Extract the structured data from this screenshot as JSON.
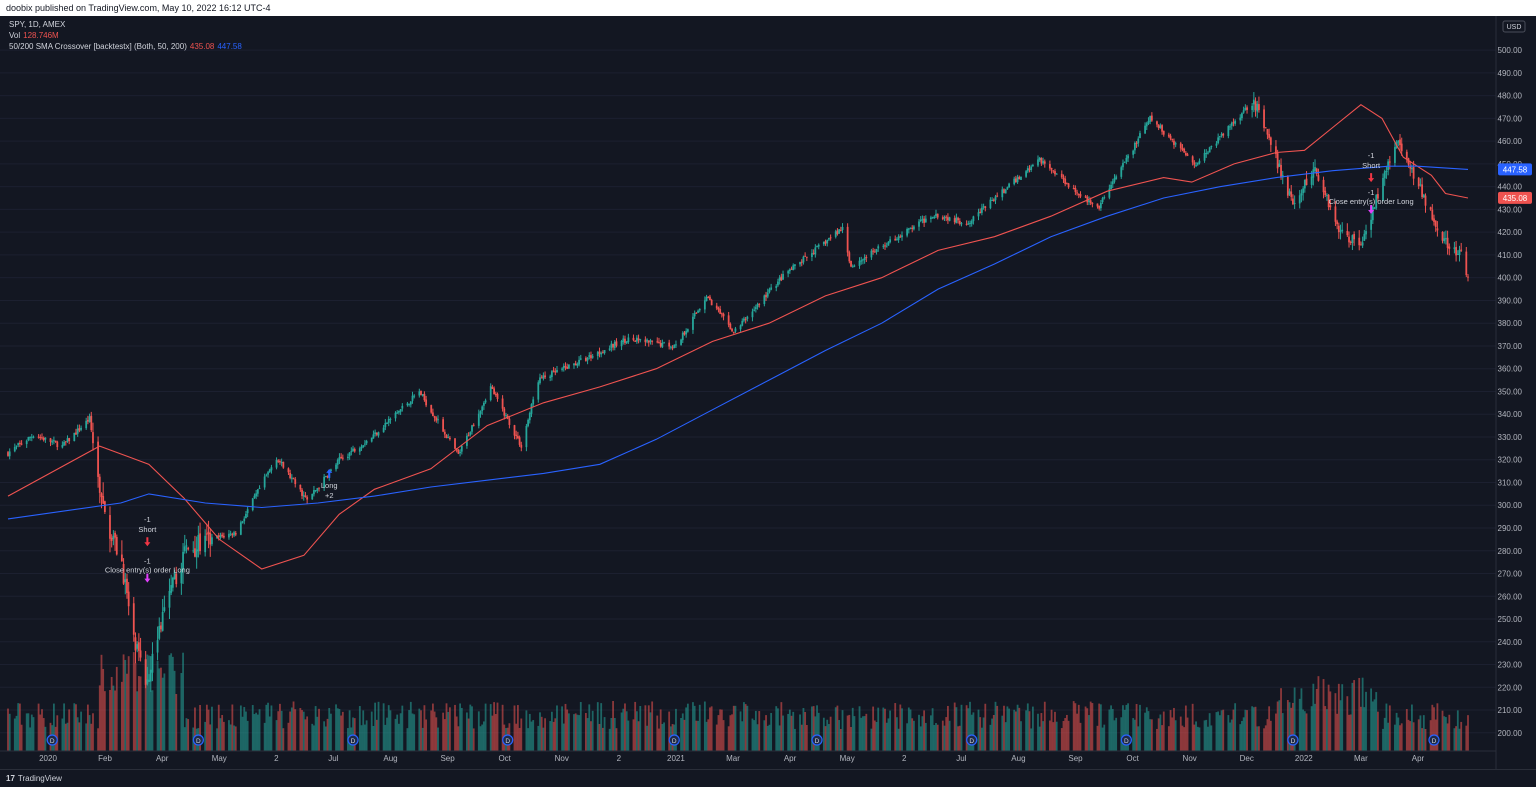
{
  "header": {
    "published": "doobix published on TradingView.com, May 10, 2022 16:12 UTC-4"
  },
  "legend": {
    "symbol": "SPY, 1D, AMEX",
    "vol_label": "Vol",
    "vol_value": "128.746M",
    "indicator_label": "50/200 SMA Crossover [backtestx] (Both, 50, 200)",
    "indicator_value_1": "435.08",
    "indicator_value_2": "447.58"
  },
  "colors": {
    "background": "#131722",
    "grid": "#1c2030",
    "up": "#26a69a",
    "down": "#ef5350",
    "sma50": "#ef5350",
    "sma200": "#2962ff",
    "text": "#d1d4dc",
    "signal_short": "#f23645",
    "signal_long": "#2962ff",
    "signal_close": "#e040fb"
  },
  "footer": {
    "logo_mark": "17",
    "brand": "TradingView"
  },
  "chart_data": {
    "type": "candlestick",
    "symbol": "SPY",
    "interval": "1D",
    "currency": "USD",
    "y_axis": {
      "range": [
        192,
        515
      ],
      "ticks": [
        200,
        210,
        220,
        230,
        240,
        250,
        260,
        270,
        280,
        290,
        300,
        310,
        320,
        330,
        340,
        350,
        360,
        370,
        380,
        390,
        400,
        410,
        420,
        430,
        440,
        450,
        460,
        470,
        480,
        490,
        500
      ]
    },
    "x_axis": {
      "labels": [
        "2020",
        "Feb",
        "Apr",
        "May",
        "2",
        "Jul",
        "Aug",
        "Sep",
        "Oct",
        "Nov",
        "2",
        "2021",
        "Mar",
        "Apr",
        "May",
        "2",
        "Jul",
        "Aug",
        "Sep",
        "Oct",
        "Nov",
        "Dec",
        "2022",
        "Mar",
        "Apr"
      ]
    },
    "price_path": [
      [
        "2020-01-02",
        323
      ],
      [
        "2020-01-17",
        331
      ],
      [
        "2020-02-03",
        326
      ],
      [
        "2020-02-19",
        338
      ],
      [
        "2020-02-27",
        297
      ],
      [
        "2020-03-09",
        275
      ],
      [
        "2020-03-16",
        240
      ],
      [
        "2020-03-23",
        222
      ],
      [
        "2020-04-01",
        248
      ],
      [
        "2020-04-15",
        280
      ],
      [
        "2020-05-01",
        285
      ],
      [
        "2020-05-15",
        288
      ],
      [
        "2020-06-08",
        321
      ],
      [
        "2020-06-26",
        302
      ],
      [
        "2020-07-15",
        320
      ],
      [
        "2020-08-03",
        330
      ],
      [
        "2020-08-31",
        350
      ],
      [
        "2020-09-23",
        322
      ],
      [
        "2020-10-12",
        352
      ],
      [
        "2020-10-30",
        326
      ],
      [
        "2020-11-09",
        355
      ],
      [
        "2020-11-30",
        362
      ],
      [
        "2020-12-31",
        373
      ],
      [
        "2021-01-29",
        370
      ],
      [
        "2021-02-16",
        392
      ],
      [
        "2021-03-04",
        376
      ],
      [
        "2021-04-01",
        400
      ],
      [
        "2021-05-07",
        422
      ],
      [
        "2021-05-12",
        405
      ],
      [
        "2021-06-30",
        428
      ],
      [
        "2021-07-19",
        424
      ],
      [
        "2021-08-31",
        452
      ],
      [
        "2021-10-04",
        430
      ],
      [
        "2021-11-04",
        470
      ],
      [
        "2021-12-01",
        450
      ],
      [
        "2021-12-31",
        475
      ],
      [
        "2022-01-04",
        478
      ],
      [
        "2022-01-27",
        432
      ],
      [
        "2022-02-09",
        448
      ],
      [
        "2022-02-24",
        420
      ],
      [
        "2022-03-08",
        415
      ],
      [
        "2022-03-29",
        460
      ],
      [
        "2022-04-13",
        437
      ],
      [
        "2022-04-29",
        412
      ],
      [
        "2022-05-06",
        410
      ],
      [
        "2022-05-10",
        398
      ]
    ],
    "series": [
      {
        "values": [
          [
            0,
            304
          ],
          [
            65,
            326
          ],
          [
            100,
            318
          ],
          [
            125,
            303
          ],
          [
            150,
            285
          ],
          [
            180,
            272
          ],
          [
            210,
            278
          ],
          [
            235,
            296
          ],
          [
            260,
            307
          ],
          [
            300,
            316
          ],
          [
            340,
            335
          ],
          [
            380,
            345
          ],
          [
            420,
            352
          ],
          [
            460,
            360
          ],
          [
            500,
            372
          ],
          [
            540,
            380
          ],
          [
            580,
            392
          ],
          [
            620,
            400
          ],
          [
            660,
            412
          ],
          [
            700,
            418
          ],
          [
            740,
            427
          ],
          [
            780,
            438
          ],
          [
            820,
            444
          ],
          [
            840,
            442
          ],
          [
            870,
            450
          ],
          [
            900,
            455
          ],
          [
            920,
            456
          ],
          [
            940,
            466
          ],
          [
            960,
            476
          ],
          [
            975,
            470
          ],
          [
            990,
            453
          ],
          [
            1010,
            445
          ],
          [
            1020,
            437
          ],
          [
            1036,
            435
          ]
        ]
      },
      {
        "values": [
          [
            0,
            294
          ],
          [
            80,
            301
          ],
          [
            100,
            305
          ],
          [
            140,
            301
          ],
          [
            180,
            299
          ],
          [
            220,
            301
          ],
          [
            260,
            304
          ],
          [
            300,
            308
          ],
          [
            340,
            311
          ],
          [
            380,
            314
          ],
          [
            420,
            318
          ],
          [
            460,
            329
          ],
          [
            500,
            342
          ],
          [
            540,
            355
          ],
          [
            580,
            368
          ],
          [
            620,
            380
          ],
          [
            660,
            395
          ],
          [
            700,
            406
          ],
          [
            740,
            418
          ],
          [
            780,
            427
          ],
          [
            820,
            435
          ],
          [
            860,
            440
          ],
          [
            900,
            444
          ],
          [
            940,
            447
          ],
          [
            980,
            449
          ],
          [
            1000,
            449
          ],
          [
            1036,
            447.58
          ]
        ]
      }
    ],
    "signals": [
      {
        "label": "-1",
        "text": "Short",
        "date": "2020-03-24",
        "price": 282
      },
      {
        "label": "-1",
        "text": "Close entry(s) order Long",
        "date": "2020-03-24",
        "price": 266
      },
      {
        "label": "+2",
        "text": "Long",
        "date": "2020-07-09",
        "price": 316
      },
      {
        "label": "-1",
        "text": "Short",
        "date": "2022-03-14",
        "price": 442
      },
      {
        "label": "-1",
        "text": "Close entry(s) order Long",
        "date": "2022-03-14",
        "price": 428
      }
    ],
    "markers": [
      "2020-01-28",
      "2020-04-23",
      "2020-07-23",
      "2020-10-22",
      "2021-01-28",
      "2021-04-22",
      "2021-07-22",
      "2021-10-21",
      "2022-01-27",
      "2022-04-20"
    ],
    "price_labels": [
      "447.58",
      "435.08"
    ]
  }
}
